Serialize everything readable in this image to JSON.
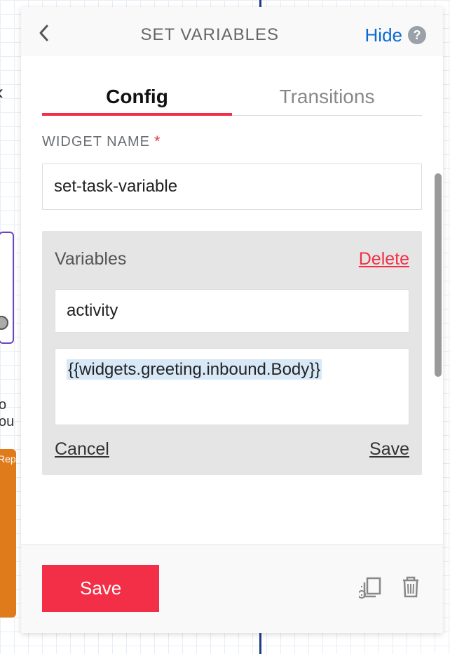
{
  "header": {
    "title": "SET VARIABLES",
    "hide_label": "Hide"
  },
  "tabs": {
    "config": "Config",
    "transitions": "Transitions"
  },
  "form": {
    "widget_name_label": "WIDGET NAME",
    "widget_name_value": "set-task-variable"
  },
  "variables": {
    "section_title": "Variables",
    "delete_label": "Delete",
    "key_value": "activity",
    "body_value": "{{widgets.greeting.inbound.Body}}",
    "cancel_label": "Cancel",
    "save_label": "Save"
  },
  "footer": {
    "save_button": "Save"
  },
  "bg": {
    "orange_text": "Rep"
  }
}
